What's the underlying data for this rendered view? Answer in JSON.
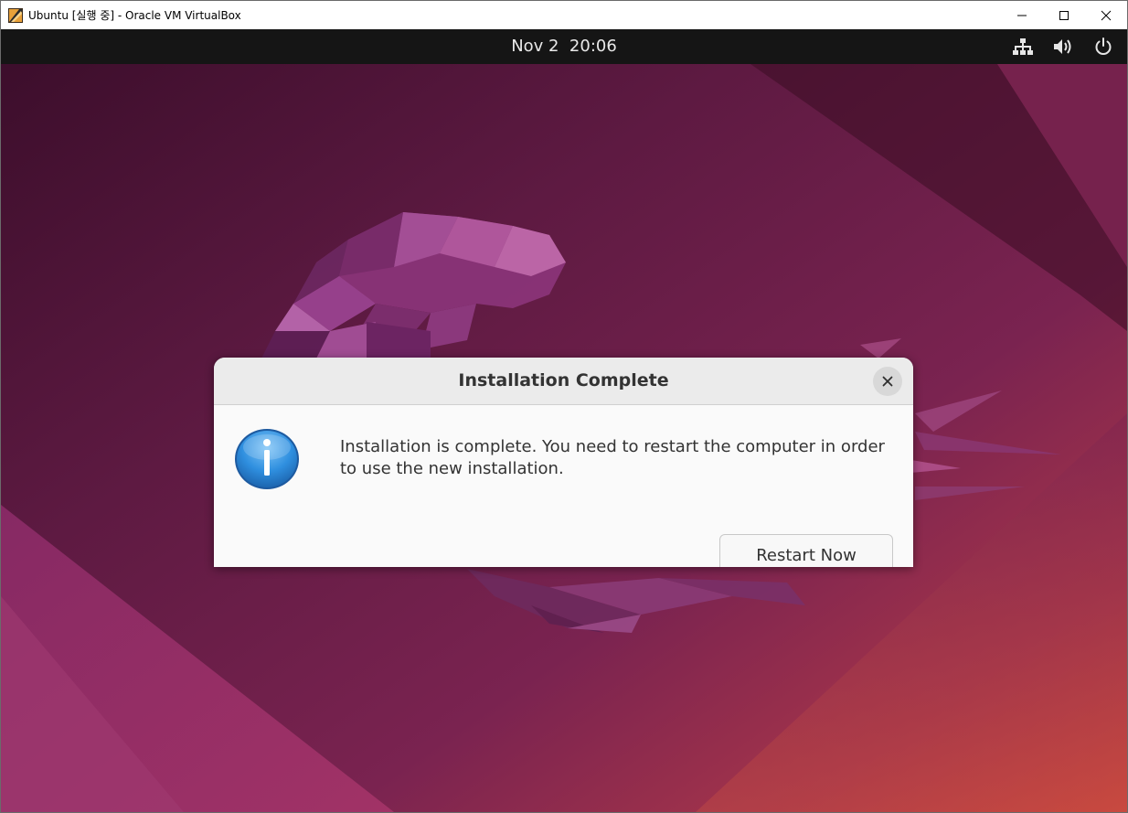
{
  "window": {
    "title": "Ubuntu [실행 중] - Oracle VM VirtualBox",
    "app_icon": "virtualbox-icon",
    "controls": [
      "minimize-icon",
      "maximize-icon",
      "close-icon"
    ]
  },
  "topbar": {
    "clock": "Nov 2  20:06",
    "tray_icons": [
      "network-icon",
      "volume-icon",
      "power-icon"
    ]
  },
  "dialog": {
    "title": "Installation Complete",
    "icon": "info-icon",
    "message": "Installation is complete. You need to restart the computer in order to use the new installation.",
    "button_label": "Restart Now",
    "close_icon": "close-icon"
  },
  "colors": {
    "topbar": "#151515",
    "wallpaper_dark": "#2c0a22",
    "wallpaper_mid": "#6e1e4c",
    "wallpaper_light": "#c64a3c",
    "dialog_bg": "#fafafa",
    "dialog_header": "#ebebeb",
    "info_blue": "#2f8fdf"
  }
}
